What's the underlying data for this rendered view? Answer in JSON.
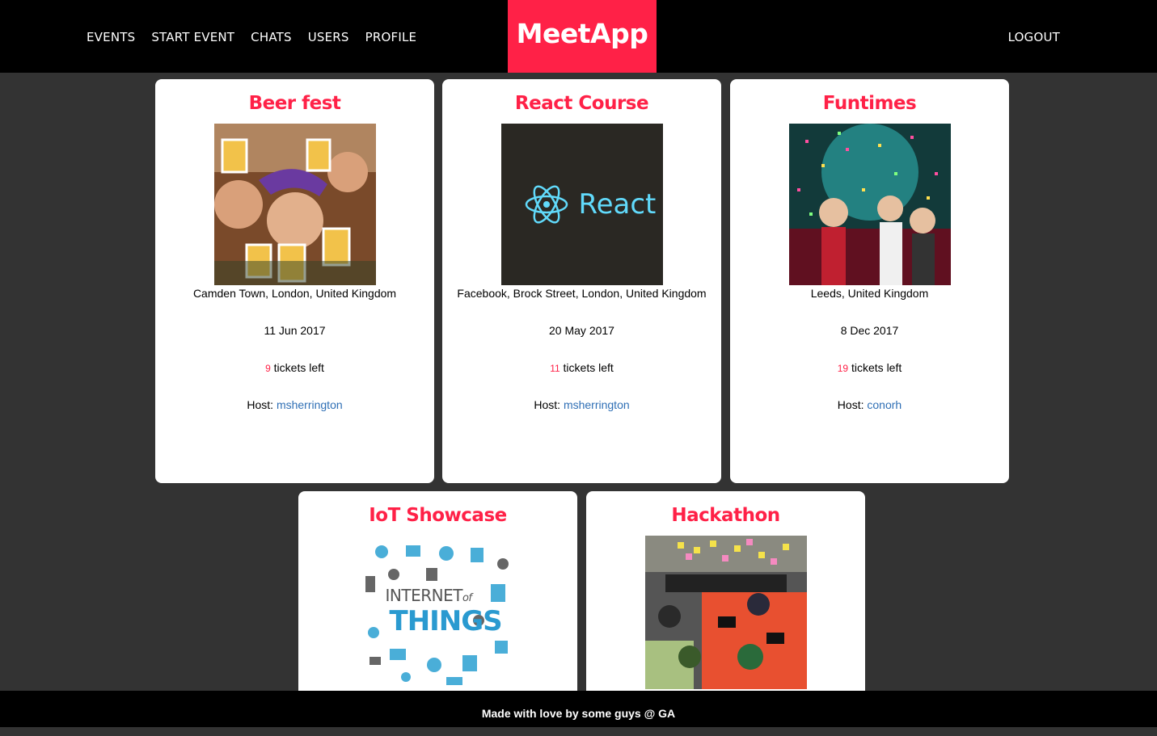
{
  "nav": {
    "items": [
      "EVENTS",
      "START EVENT",
      "CHATS",
      "USERS",
      "PROFILE"
    ],
    "brand": "MeetApp",
    "logout": "LOGOUT"
  },
  "events": [
    {
      "title": "Beer fest",
      "location": "Camden Town, London, United Kingdom",
      "date": "11 Jun 2017",
      "tickets_count": "9",
      "tickets_suffix": " tickets left",
      "host_label": "Host: ",
      "host": "msherrington"
    },
    {
      "title": "React Course",
      "location": "Facebook, Brock Street, London, United Kingdom",
      "date": "20 May 2017",
      "tickets_count": "11",
      "tickets_suffix": " tickets left",
      "host_label": "Host: ",
      "host": "msherrington",
      "logo_text": "React"
    },
    {
      "title": "Funtimes",
      "location": "Leeds, United Kingdom",
      "date": "8 Dec 2017",
      "tickets_count": "19",
      "tickets_suffix": " tickets left",
      "host_label": "Host: ",
      "host": "conorh"
    },
    {
      "title": "IoT Showcase",
      "img_text_top": "INTERNET",
      "img_text_of": "of",
      "img_text_bottom": "THINGS"
    },
    {
      "title": "Hackathon"
    }
  ],
  "footer": {
    "text": "Made with love by some guys @ GA"
  },
  "colors": {
    "accent": "#ff2147",
    "link": "#2f6fb5",
    "background": "#333333"
  }
}
